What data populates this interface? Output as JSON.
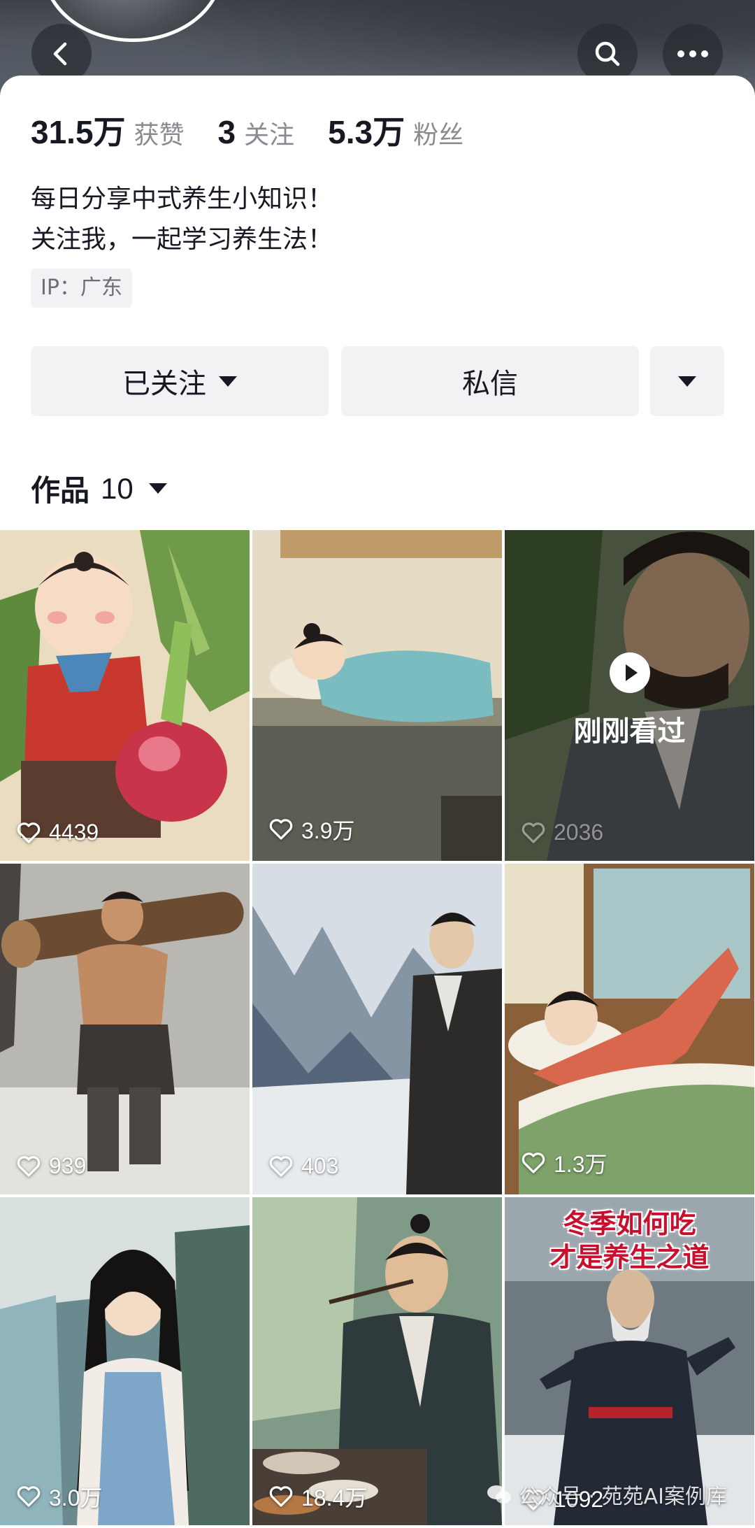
{
  "profile": {
    "stats": [
      {
        "value": "31.5万",
        "label": "获赞"
      },
      {
        "value": "3",
        "label": "关注"
      },
      {
        "value": "5.3万",
        "label": "粉丝"
      }
    ],
    "bio_line1": "每日分享中式养生小知识！",
    "bio_line2": "关注我，一起学习养生法！",
    "ip": "IP：广东"
  },
  "actions": {
    "follow_label": "已关注",
    "message_label": "私信"
  },
  "works": {
    "label": "作品",
    "count": "10"
  },
  "grid": {
    "tiles": [
      {
        "likes": "4439"
      },
      {
        "likes": "3.9万"
      },
      {
        "likes": "2036",
        "overlay": "刚刚看过"
      },
      {
        "likes": "939"
      },
      {
        "likes": "403"
      },
      {
        "likes": "1.3万"
      },
      {
        "likes": "3.0万"
      },
      {
        "likes": "18.4万"
      },
      {
        "likes": "1092",
        "title_line1": "冬季如何吃",
        "title_line2": "才是养生之道"
      }
    ]
  },
  "watermark": "公众号 · 苑苑AI案例库",
  "icons": [
    "back-arrow-icon",
    "search-icon",
    "more-icon",
    "caret-down-icon",
    "heart-icon",
    "play-icon",
    "wechat-icon"
  ]
}
